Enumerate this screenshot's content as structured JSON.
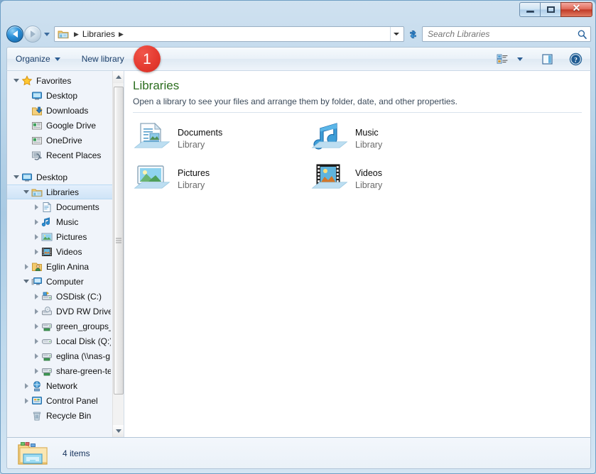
{
  "window": {
    "minimize_label": "Minimize",
    "maximize_label": "Maximize",
    "close_label": "✕"
  },
  "address": {
    "back_label": "Back",
    "forward_label": "Forward",
    "recent_label": "Recent pages",
    "crumb_root": "Libraries",
    "sep": "▶",
    "dropdown_label": "Previous locations",
    "refresh_label": "Refresh"
  },
  "search": {
    "placeholder": "Search Libraries",
    "value": "",
    "icon": "search-icon"
  },
  "toolbar": {
    "organize_label": "Organize",
    "new_library_label": "New library",
    "view_label": "Change your view",
    "preview_label": "Show the preview pane",
    "help_label": "Get help"
  },
  "annotation": {
    "badge_number": "1"
  },
  "navigation": {
    "items": [
      {
        "label": "Favorites",
        "indent": 0,
        "expander": "expanded",
        "icon": "star-icon",
        "selected": false
      },
      {
        "label": "Desktop",
        "indent": 1,
        "expander": "none",
        "icon": "desktop-icon",
        "selected": false
      },
      {
        "label": "Downloads",
        "indent": 1,
        "expander": "none",
        "icon": "downloads-icon",
        "selected": false
      },
      {
        "label": "Google Drive",
        "indent": 1,
        "expander": "none",
        "icon": "drive-folder-icon",
        "selected": false
      },
      {
        "label": "OneDrive",
        "indent": 1,
        "expander": "none",
        "icon": "drive-folder-icon",
        "selected": false
      },
      {
        "label": "Recent Places",
        "indent": 1,
        "expander": "none",
        "icon": "recent-places-icon",
        "selected": false
      },
      {
        "label": "Desktop",
        "indent": 0,
        "expander": "expanded",
        "icon": "desktop-icon",
        "selected": false,
        "gap_before": true
      },
      {
        "label": "Libraries",
        "indent": 1,
        "expander": "expanded",
        "icon": "libraries-icon",
        "selected": true
      },
      {
        "label": "Documents",
        "indent": 2,
        "expander": "collapsed",
        "icon": "documents-icon",
        "selected": false
      },
      {
        "label": "Music",
        "indent": 2,
        "expander": "collapsed",
        "icon": "music-icon",
        "selected": false
      },
      {
        "label": "Pictures",
        "indent": 2,
        "expander": "collapsed",
        "icon": "pictures-icon",
        "selected": false
      },
      {
        "label": "Videos",
        "indent": 2,
        "expander": "collapsed",
        "icon": "videos-icon",
        "selected": false
      },
      {
        "label": "Eglin  Anina",
        "indent": 1,
        "expander": "collapsed",
        "icon": "user-icon",
        "selected": false
      },
      {
        "label": "Computer",
        "indent": 1,
        "expander": "expanded",
        "icon": "computer-icon",
        "selected": false
      },
      {
        "label": "OSDisk (C:)",
        "indent": 2,
        "expander": "collapsed",
        "icon": "hdd-system-icon",
        "selected": false
      },
      {
        "label": "DVD RW Drive (",
        "indent": 2,
        "expander": "collapsed",
        "icon": "dvd-drive-icon",
        "selected": false
      },
      {
        "label": "green_groups_i",
        "indent": 2,
        "expander": "collapsed",
        "icon": "network-drive-icon",
        "selected": false
      },
      {
        "label": "Local Disk (Q:)",
        "indent": 2,
        "expander": "collapsed",
        "icon": "hdd-icon",
        "selected": false
      },
      {
        "label": "eglina (\\\\nas-g",
        "indent": 2,
        "expander": "collapsed",
        "icon": "network-drive-icon",
        "selected": false
      },
      {
        "label": "share-green-te",
        "indent": 2,
        "expander": "collapsed",
        "icon": "network-drive-icon",
        "selected": false
      },
      {
        "label": "Network",
        "indent": 1,
        "expander": "collapsed",
        "icon": "network-icon",
        "selected": false
      },
      {
        "label": "Control Panel",
        "indent": 1,
        "expander": "collapsed",
        "icon": "control-panel-icon",
        "selected": false
      },
      {
        "label": "Recycle Bin",
        "indent": 1,
        "expander": "none",
        "icon": "recycle-bin-icon",
        "selected": false
      }
    ],
    "scrollbar": {
      "up_label": "Scroll up",
      "down_label": "Scroll down"
    }
  },
  "main": {
    "title": "Libraries",
    "subtitle": "Open a library to see your files and arrange them by folder, date, and other properties.",
    "libraries": [
      {
        "name": "Documents",
        "kind": "Library",
        "icon": "documents-library-icon"
      },
      {
        "name": "Music",
        "kind": "Library",
        "icon": "music-library-icon"
      },
      {
        "name": "Pictures",
        "kind": "Library",
        "icon": "pictures-library-icon"
      },
      {
        "name": "Videos",
        "kind": "Library",
        "icon": "videos-library-icon"
      }
    ]
  },
  "status": {
    "item_count": "4 items",
    "icon": "libraries-folder-icon"
  },
  "colors": {
    "title_green": "#2c6e1f",
    "badge_red": "#e53b30",
    "selection_blue": "#cfe4f7",
    "frame_blue": "#6e9ec4"
  }
}
